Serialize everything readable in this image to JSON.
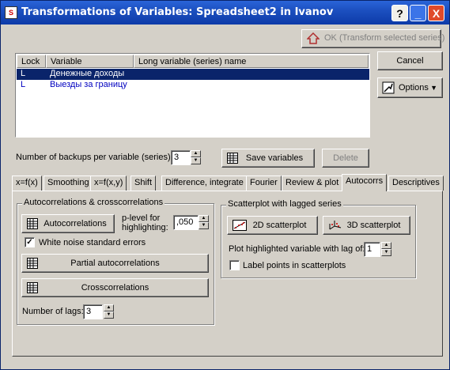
{
  "window": {
    "title": "Transformations of Variables: Spreadsheet2 in Ivanov",
    "help_btn": "?",
    "min_btn": "_",
    "close_btn": "X"
  },
  "toolbar": {
    "ok_label": "OK (Transform selected series)",
    "cancel_label": "Cancel",
    "options_label": "Options"
  },
  "variables": {
    "columns": [
      "Lock",
      "Variable",
      "Long variable (series) name"
    ],
    "rows": [
      {
        "lock": "L",
        "variable": "Денежные доходы",
        "long_name": "",
        "selected": true
      },
      {
        "lock": "L",
        "variable": "Выезды за границу",
        "long_name": "",
        "selected": false
      }
    ]
  },
  "backups": {
    "label": "Number of backups per variable (series):",
    "value": "3",
    "save_label": "Save variables",
    "delete_label": "Delete"
  },
  "tabs": [
    {
      "label": "x=f(x)",
      "active": false
    },
    {
      "label": "Smoothing",
      "active": false
    },
    {
      "label": "x=f(x,y)",
      "active": false
    },
    {
      "label": "Shift",
      "active": false
    },
    {
      "label": "Difference, integrate",
      "active": false
    },
    {
      "label": "Fourier",
      "active": false
    },
    {
      "label": "Review & plot",
      "active": false
    },
    {
      "label": "Autocorrs",
      "active": true
    },
    {
      "label": "Descriptives",
      "active": false
    }
  ],
  "autocorr": {
    "group_title": "Autocorrelations & crosscorrelations",
    "autocorr_btn": "Autocorrelations",
    "plevel_label": "p-level for highlighting:",
    "plevel_value": ",050",
    "white_noise_label": "White noise standard errors",
    "white_noise_checked": true,
    "partial_btn": "Partial autocorrelations",
    "cross_btn": "Crosscorrelations",
    "lags_label": "Number of lags:",
    "lags_value": "3"
  },
  "scatter": {
    "group_title": "Scatterplot with lagged series",
    "scatter2d_btn": "2D scatterplot",
    "scatter3d_btn": "3D scatterplot",
    "lag_label": "Plot highlighted variable with lag of:",
    "lag_value": "1",
    "label_points": "Label points in scatterplots",
    "label_points_checked": false
  },
  "colors": {
    "title_bar": "#1c50c0",
    "selection": "#0a246a",
    "variable_text": "#0000c0"
  }
}
